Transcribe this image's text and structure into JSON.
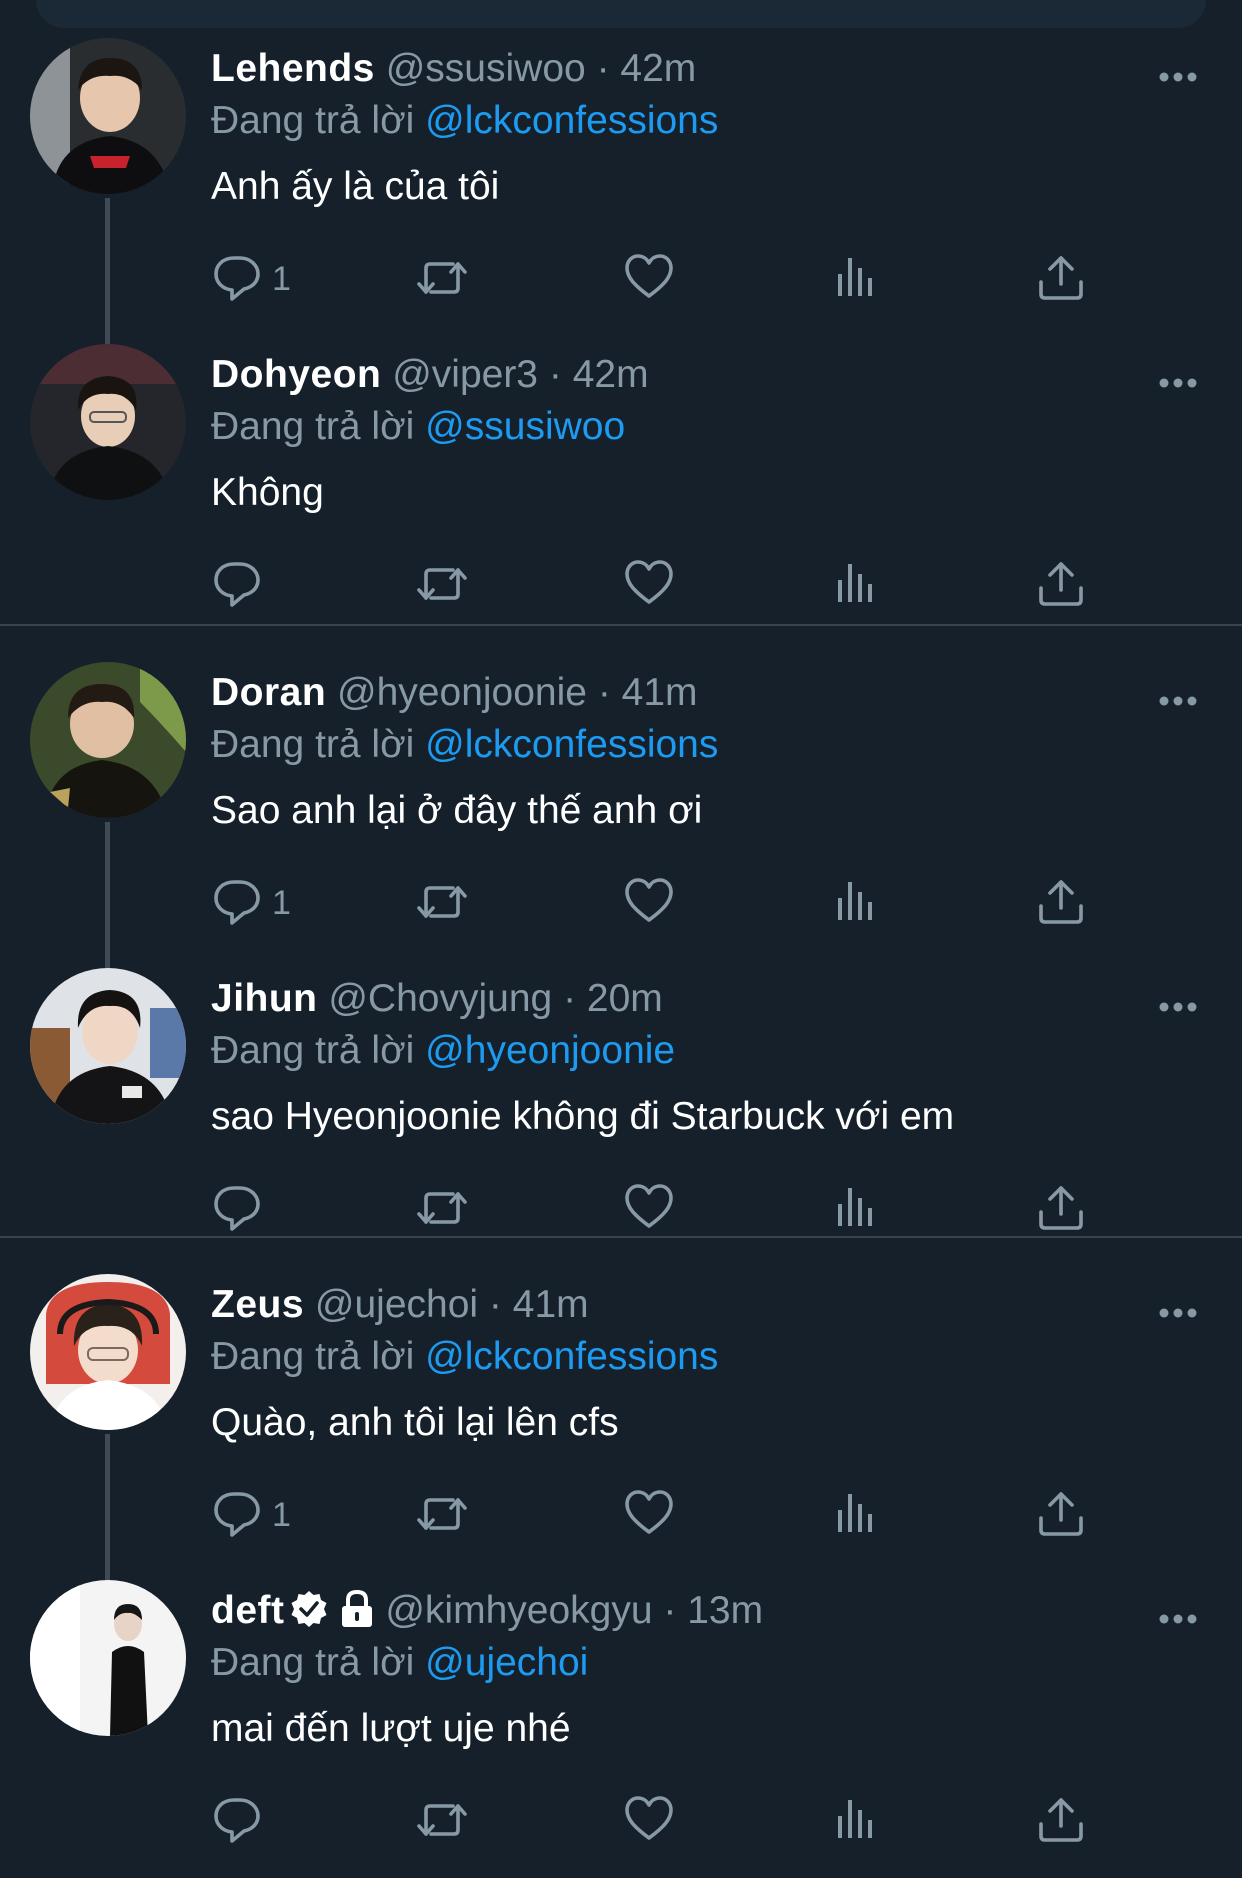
{
  "reply_prefix": "Đang trả lời",
  "colors": {
    "background": "#15202b",
    "secondary_text": "#8899a6",
    "link": "#1d9bf0",
    "divider": "#38444d"
  },
  "icons": [
    "reply-icon",
    "retweet-icon",
    "like-icon",
    "views-icon",
    "share-icon",
    "more-icon",
    "verified-icon",
    "lock-icon"
  ],
  "tweets": [
    {
      "name": "Lehends",
      "handle": "@ssusiwoo",
      "dot": "·",
      "time": "42m",
      "reply_to": "@lckconfessions",
      "text": "Anh ấy là của tôi",
      "reply_count": "1"
    },
    {
      "name": "Dohyeon",
      "handle": "@viper3",
      "dot": "·",
      "time": "42m",
      "reply_to": "@ssusiwoo",
      "text": "Không",
      "reply_count": ""
    },
    {
      "name": "Doran",
      "handle": "@hyeonjoonie",
      "dot": "·",
      "time": "41m",
      "reply_to": "@lckconfessions",
      "text": "Sao anh lại ở đây thế anh ơi",
      "reply_count": "1"
    },
    {
      "name": "Jihun",
      "handle": "@Chovyjung",
      "dot": "·",
      "time": "20m",
      "reply_to": "@hyeonjoonie",
      "text": "sao Hyeonjoonie không đi Starbuck với em",
      "reply_count": ""
    },
    {
      "name": "Zeus",
      "handle": "@ujechoi",
      "dot": "·",
      "time": "41m",
      "reply_to": "@lckconfessions",
      "text": "Quào, anh tôi lại lên cfs",
      "reply_count": "1"
    },
    {
      "name": "deft",
      "handle": "@kimhyeokgyu",
      "dot": "·",
      "time": "13m",
      "reply_to": "@ujechoi",
      "text": "mai đến lượt uje nhé",
      "reply_count": "",
      "verified": true,
      "protected": true
    }
  ]
}
